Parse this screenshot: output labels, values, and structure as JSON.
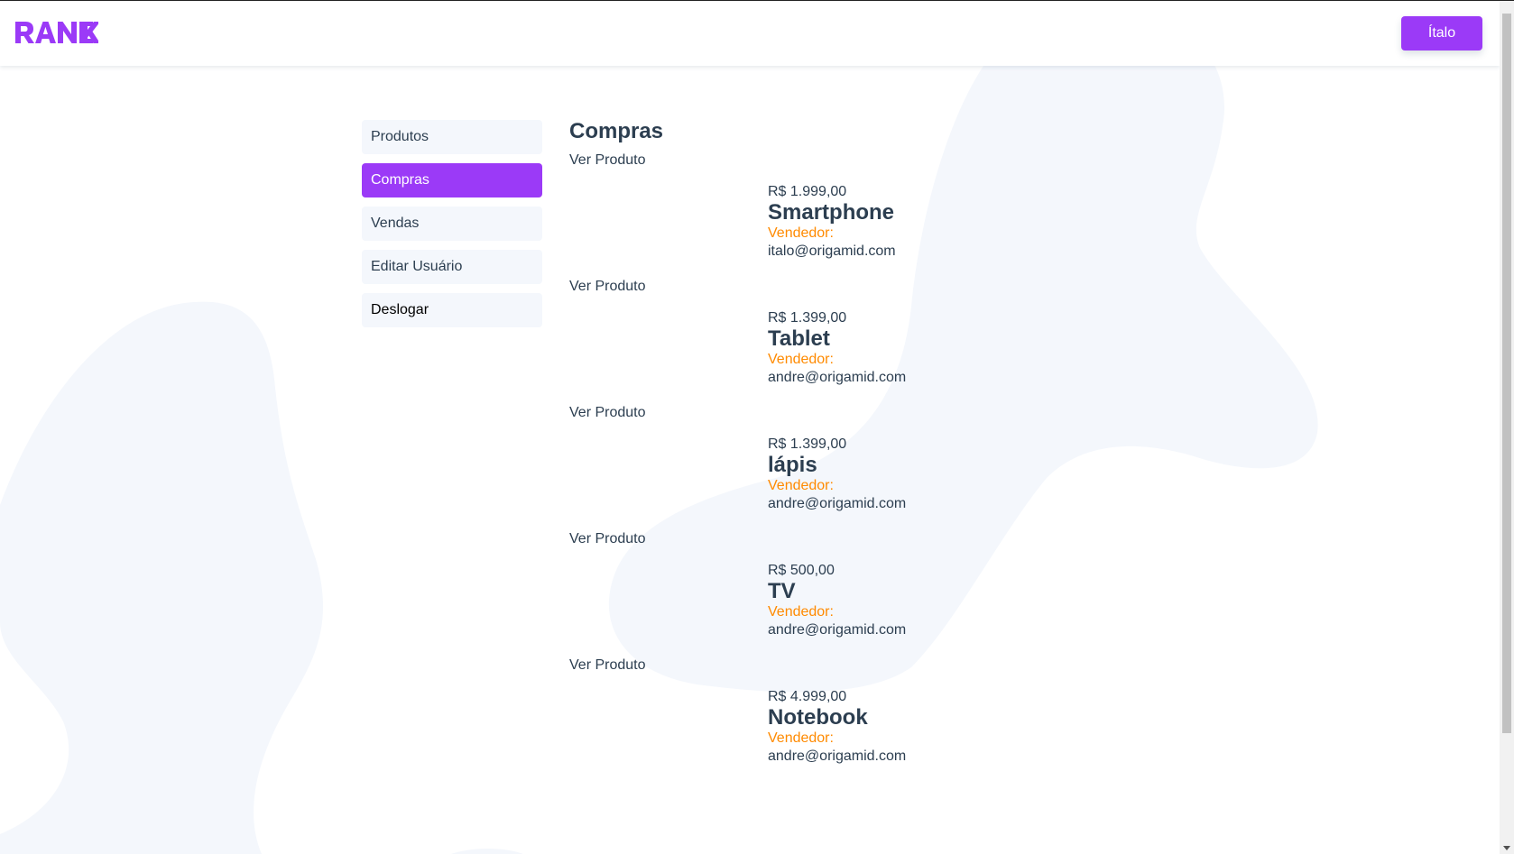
{
  "app": {
    "logo_text": "RANEK",
    "brand_color": "#9b3af7"
  },
  "header": {
    "user_button": "Ítalo"
  },
  "sidebar": {
    "items": [
      {
        "label": "Produtos"
      },
      {
        "label": "Compras"
      },
      {
        "label": "Vendas"
      },
      {
        "label": "Editar Usuário"
      },
      {
        "label": "Deslogar"
      }
    ],
    "active": "Compras"
  },
  "main": {
    "title": "Compras",
    "seller_label": "Vendedor:",
    "seller_label_color": "#ff8a00",
    "purchases": [
      {
        "link": "Ver Produto",
        "price": "R$ 1.999,00",
        "name": "Smartphone",
        "seller": "italo@origamid.com"
      },
      {
        "link": "Ver Produto",
        "price": "R$ 1.399,00",
        "name": "Tablet",
        "seller": "andre@origamid.com"
      },
      {
        "link": "Ver Produto",
        "price": "R$ 1.399,00",
        "name": "lápis",
        "seller": "andre@origamid.com"
      },
      {
        "link": "Ver Produto",
        "price": "R$ 500,00",
        "name": "TV",
        "seller": "andre@origamid.com"
      },
      {
        "link": "Ver Produto",
        "price": "R$ 4.999,00",
        "name": "Notebook",
        "seller": "andre@origamid.com"
      }
    ]
  }
}
